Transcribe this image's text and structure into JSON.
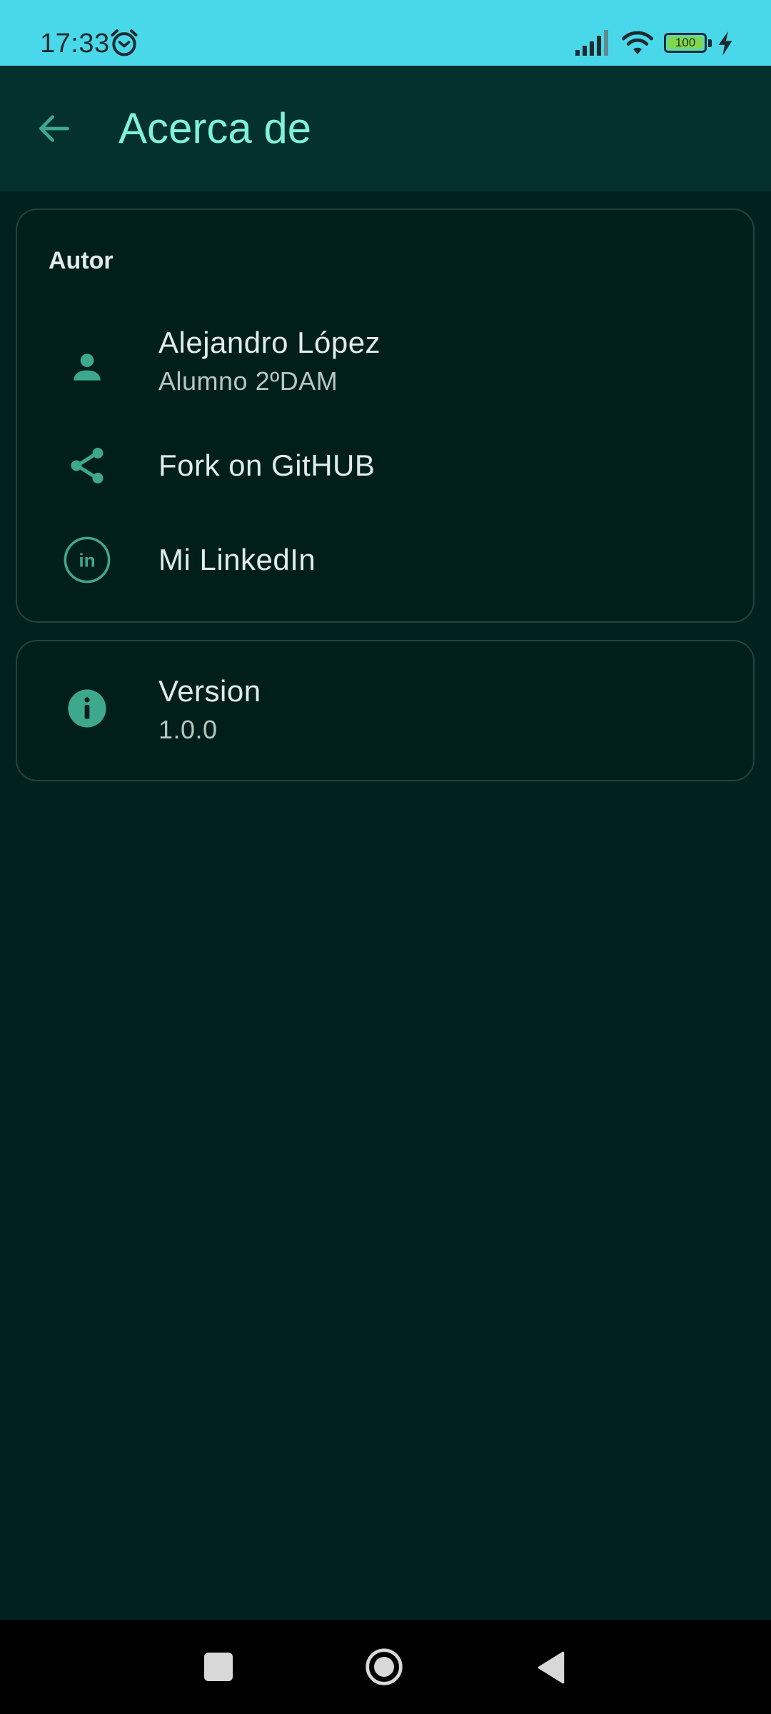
{
  "status_bar": {
    "time": "17:33",
    "battery_level": "100",
    "icons": [
      "alarm-icon",
      "signal-icon",
      "wifi-icon",
      "battery-icon",
      "charging-bolt-icon"
    ]
  },
  "app_bar": {
    "title": "Acerca de",
    "back_icon": "arrow-back-icon"
  },
  "author_card": {
    "section_title": "Autor",
    "items": [
      {
        "title": "Alejandro López",
        "subtitle": "Alumno 2ºDAM",
        "icon": "person-icon"
      },
      {
        "title": "Fork on GitHUB",
        "icon": "share-icon"
      },
      {
        "title": "Mi LinkedIn",
        "icon": "linkedin-icon"
      }
    ]
  },
  "version_card": {
    "title": "Version",
    "subtitle": "1.0.0",
    "icon": "info-icon"
  },
  "nav_bar": {
    "icons": [
      "recents-icon",
      "home-icon",
      "back-icon"
    ]
  },
  "colors": {
    "status_bar": "#49d8ea",
    "app_bar": "#04302d",
    "background": "#00211d",
    "accent_title": "#7ff3d7",
    "icon_accent": "#3ea88d",
    "card_border": "#24433e"
  }
}
